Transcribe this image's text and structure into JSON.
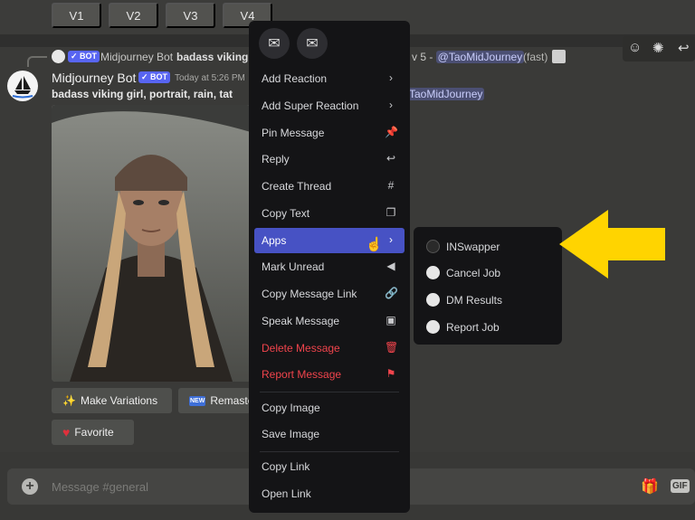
{
  "variations": [
    "V1",
    "V2",
    "V3",
    "V4"
  ],
  "reference": {
    "bot_tag": "✓ BOT",
    "author": "Midjourney Bot",
    "text": "badass viking g",
    "tail": "v 5 - ",
    "mention": "@TaoMidJourney",
    "speed": "(fast)"
  },
  "message": {
    "author": "Midjourney Bot",
    "bot_tag": "✓ BOT",
    "timestamp": "Today at 5:26 PM",
    "prompt": "badass viking girl, portrait, rain, tat",
    "prompt_tail": "TaoMidJourney"
  },
  "actions": {
    "make_variations": "Make Variations",
    "remaster": "Remaste",
    "new_badge": "NEW",
    "favorite": "Favorite"
  },
  "context_menu": {
    "items": [
      {
        "label": "Add Reaction",
        "icon": "›",
        "kind": "normal"
      },
      {
        "label": "Add Super Reaction",
        "icon": "›",
        "kind": "normal"
      },
      {
        "label": "Pin Message",
        "icon": "📌",
        "kind": "normal"
      },
      {
        "label": "Reply",
        "icon": "↩",
        "kind": "normal"
      },
      {
        "label": "Create Thread",
        "icon": "#",
        "kind": "normal"
      },
      {
        "label": "Copy Text",
        "icon": "❐",
        "kind": "normal"
      },
      {
        "label": "Apps",
        "icon": "›",
        "kind": "active"
      },
      {
        "label": "Mark Unread",
        "icon": "◀",
        "kind": "normal"
      },
      {
        "label": "Copy Message Link",
        "icon": "🔗",
        "kind": "normal"
      },
      {
        "label": "Speak Message",
        "icon": "▣",
        "kind": "normal"
      },
      {
        "label": "Delete Message",
        "icon": "🗑",
        "kind": "danger"
      },
      {
        "label": "Report Message",
        "icon": "⚑",
        "kind": "danger"
      },
      {
        "label": "Copy Image",
        "icon": "",
        "kind": "normal"
      },
      {
        "label": "Save Image",
        "icon": "",
        "kind": "normal"
      },
      {
        "label": "Copy Link",
        "icon": "",
        "kind": "normal"
      },
      {
        "label": "Open Link",
        "icon": "",
        "kind": "normal"
      }
    ]
  },
  "apps_submenu": {
    "items": [
      "INSwapper",
      "Cancel Job",
      "DM Results",
      "Report Job"
    ]
  },
  "composer": {
    "placeholder": "Message #general",
    "gif_label": "GIF"
  },
  "colors": {
    "accent": "#4752c4",
    "danger": "#f1444c",
    "arrow": "#ffd400"
  }
}
